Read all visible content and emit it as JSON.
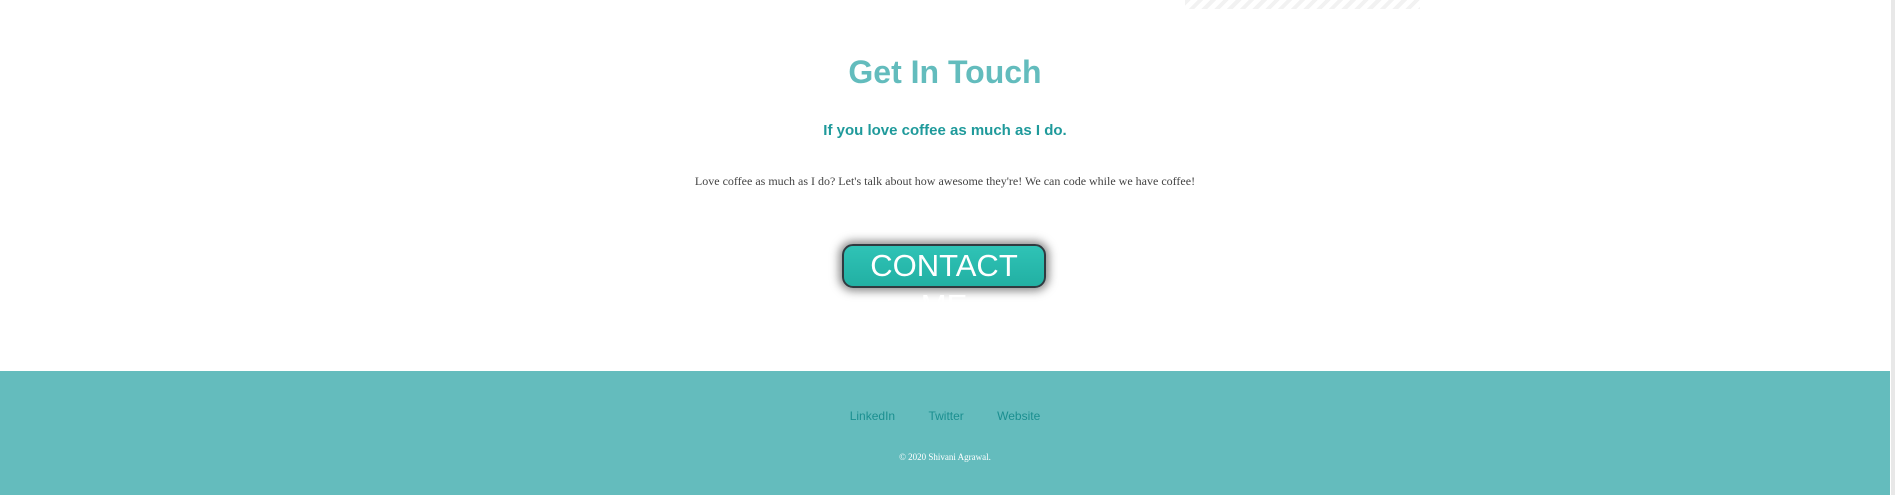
{
  "contact": {
    "title": "Get In Touch",
    "subtitle": "If you love coffee as much as I do.",
    "text": "Love coffee as much as I do? Let's talk about how awesome they're! We can code while we have coffee!",
    "button_label": "CONTACT ME"
  },
  "footer": {
    "links": {
      "linkedin": "LinkedIn",
      "twitter": "Twitter",
      "website": "Website"
    },
    "copyright": "© 2020 Shivani Agrawal."
  },
  "colors": {
    "accent": "#64bcbd",
    "subtitle": "#1f9a9b",
    "button": "#2fc3b6",
    "body_text": "#444444"
  }
}
